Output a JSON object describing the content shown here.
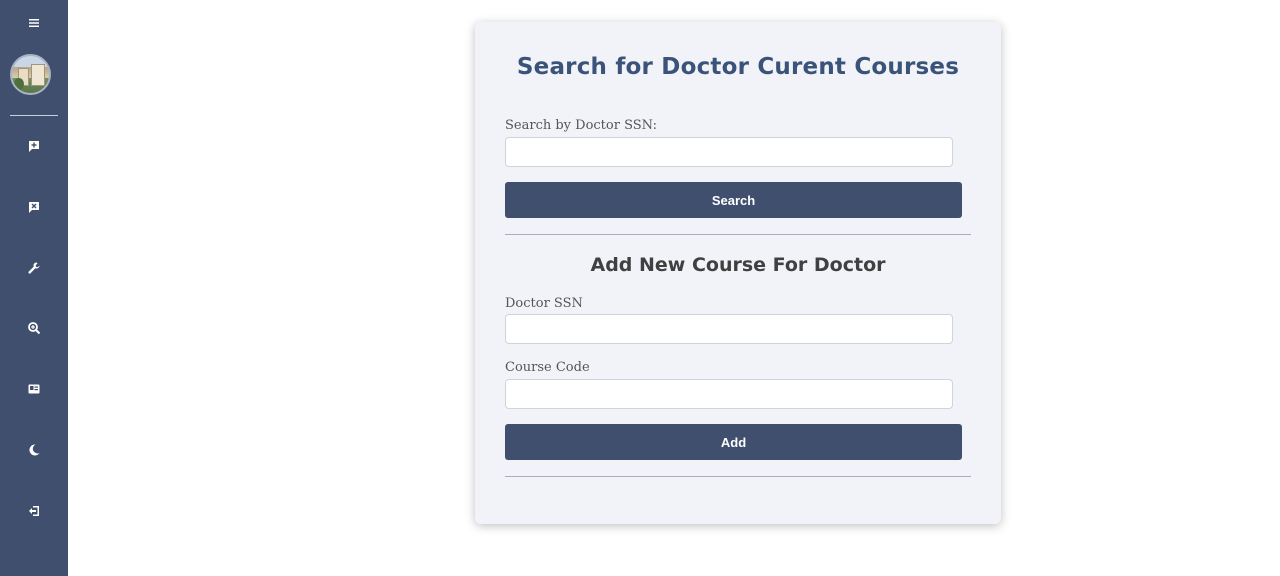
{
  "sidebar": {
    "menu_icon": "hamburger-menu-icon",
    "avatar": "user-avatar-building-photo",
    "items": [
      {
        "icon": "add-comment-icon"
      },
      {
        "icon": "remove-comment-icon"
      },
      {
        "icon": "wrench-icon"
      },
      {
        "icon": "search-zoom-icon"
      },
      {
        "icon": "id-card-icon"
      },
      {
        "icon": "moon-icon"
      },
      {
        "icon": "logout-icon"
      }
    ],
    "background": "#3f4f6d"
  },
  "search_section": {
    "title": "Search for Doctor Curent Courses",
    "ssn_label": "Search by Doctor SSN:",
    "ssn_value": "",
    "search_button": "Search"
  },
  "add_section": {
    "title": "Add New Course For Doctor",
    "doctor_ssn_label": "Doctor SSN",
    "doctor_ssn_value": "",
    "course_code_label": "Course Code",
    "course_code_value": "",
    "add_button": "Add"
  },
  "colors": {
    "accent": "#3f4f6d",
    "title": "#3a5379",
    "card_background": "#f2f3f8"
  }
}
